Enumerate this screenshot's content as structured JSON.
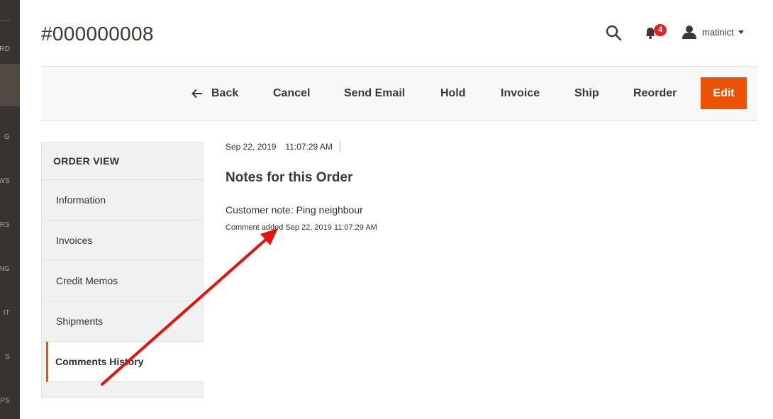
{
  "nav": {
    "labels": [
      "ARD",
      "G",
      "EWS",
      "ERS",
      "NG",
      "IT",
      "S",
      "PS"
    ]
  },
  "header": {
    "title": "#000000008",
    "notification_count": "4",
    "username": "matinict"
  },
  "toolbar": {
    "back": "Back",
    "cancel": "Cancel",
    "send_email": "Send Email",
    "hold": "Hold",
    "invoice": "Invoice",
    "ship": "Ship",
    "reorder": "Reorder",
    "edit": "Edit"
  },
  "sidebar": {
    "title": "ORDER VIEW",
    "items": [
      {
        "label": "Information"
      },
      {
        "label": "Invoices"
      },
      {
        "label": "Credit Memos"
      },
      {
        "label": "Shipments"
      },
      {
        "label": "Comments History"
      }
    ]
  },
  "main": {
    "date": "Sep 22, 2019",
    "time": "11:07:29 AM",
    "notes_title": "Notes for this Order",
    "customer_note": "Customer note: Ping neighbour",
    "comment_added": "Comment added Sep 22, 2019 11:07:29 AM"
  },
  "colors": {
    "accent": "#eb5202",
    "nav_bg": "#373330",
    "badge": "#e22626",
    "annotation": "#e8120c"
  },
  "icons": [
    "search-icon",
    "bell-icon",
    "user-icon",
    "caret-down-icon",
    "back-arrow-icon"
  ]
}
